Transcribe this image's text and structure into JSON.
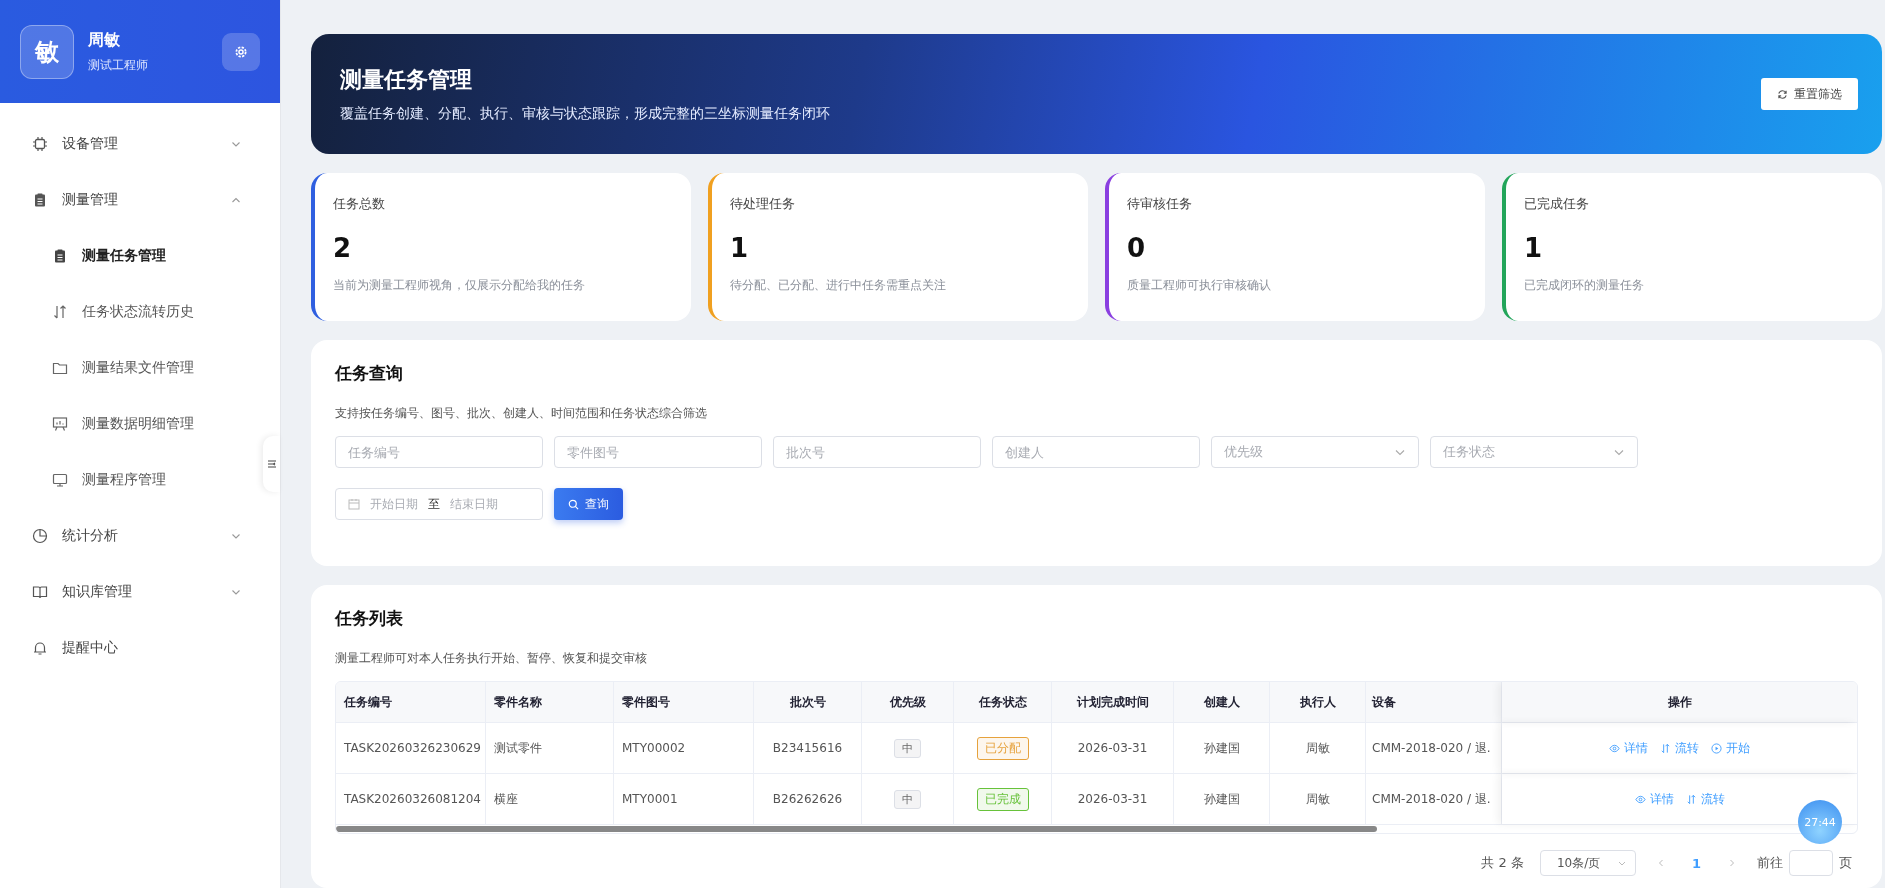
{
  "sidebar": {
    "avatar": "敏",
    "name": "周敏",
    "role": "测试工程师",
    "items": [
      {
        "label": "设备管理",
        "kind": "group",
        "expanded": false
      },
      {
        "label": "测量管理",
        "kind": "group",
        "expanded": true,
        "children": [
          {
            "label": "测量任务管理",
            "selected": true
          },
          {
            "label": "任务状态流转历史",
            "selected": false
          },
          {
            "label": "测量结果文件管理",
            "selected": false
          },
          {
            "label": "测量数据明细管理",
            "selected": false
          },
          {
            "label": "测量程序管理",
            "selected": false
          }
        ]
      },
      {
        "label": "统计分析",
        "kind": "group",
        "expanded": false
      },
      {
        "label": "知识库管理",
        "kind": "group",
        "expanded": false
      },
      {
        "label": "提醒中心",
        "kind": "link"
      }
    ]
  },
  "banner": {
    "title": "测量任务管理",
    "subtitle": "覆盖任务创建、分配、执行、审核与状态跟踪，形成完整的三坐标测量任务闭环",
    "reset_button": "重置筛选"
  },
  "stats": [
    {
      "label": "任务总数",
      "value": "2",
      "note": "当前为测量工程师视角，仅展示分配给我的任务",
      "color": "#2f5fe0"
    },
    {
      "label": "待处理任务",
      "value": "1",
      "note": "待分配、已分配、进行中任务需重点关注",
      "color": "#f0a020"
    },
    {
      "label": "待审核任务",
      "value": "0",
      "note": "质量工程师可执行审核确认",
      "color": "#8a3fe0"
    },
    {
      "label": "已完成任务",
      "value": "1",
      "note": "已完成闭环的测量任务",
      "color": "#22a55a"
    }
  ],
  "query": {
    "title": "任务查询",
    "description": "支持按任务编号、图号、批次、创建人、时间范围和任务状态综合筛选",
    "fields": [
      {
        "placeholder": "任务编号",
        "kind": "text"
      },
      {
        "placeholder": "零件图号",
        "kind": "text"
      },
      {
        "placeholder": "批次号",
        "kind": "text"
      },
      {
        "placeholder": "创建人",
        "kind": "text"
      },
      {
        "placeholder": "优先级",
        "kind": "select"
      },
      {
        "placeholder": "任务状态",
        "kind": "select"
      }
    ],
    "date_range": {
      "start_placeholder": "开始日期",
      "separator": "至",
      "end_placeholder": "结束日期"
    },
    "search_button": "查询"
  },
  "task_list": {
    "title": "任务列表",
    "description": "测量工程师可对本人任务执行开始、暂停、恢复和提交审核",
    "columns": [
      "任务编号",
      "零件名称",
      "零件图号",
      "批次号",
      "优先级",
      "任务状态",
      "计划完成时间",
      "创建人",
      "执行人",
      "设备",
      "操作"
    ],
    "rows": [
      {
        "task_no": "TASK20260326230629",
        "part_name": "测试零件",
        "drawing_no": "MTY00002",
        "batch": "B23415616",
        "priority": "中",
        "status": {
          "label": "已分配",
          "color": "#e6a23c"
        },
        "due": "2026-03-31",
        "creator": "孙建国",
        "executor": "周敏",
        "device": "CMM-2018-020 / 退.",
        "actions": [
          {
            "label": "详情",
            "kind": "detail"
          },
          {
            "label": "流转",
            "kind": "transfer"
          },
          {
            "label": "开始",
            "kind": "start"
          }
        ]
      },
      {
        "task_no": "TASK20260326081204",
        "part_name": "横座",
        "drawing_no": "MTY0001",
        "batch": "B26262626",
        "priority": "中",
        "status": {
          "label": "已完成",
          "color": "#67c23a"
        },
        "due": "2026-03-31",
        "creator": "孙建国",
        "executor": "周敏",
        "device": "CMM-2018-020 / 退.",
        "actions": [
          {
            "label": "详情",
            "kind": "detail"
          },
          {
            "label": "流转",
            "kind": "transfer"
          }
        ]
      }
    ]
  },
  "pagination": {
    "total": "共 2 条",
    "page_size": "10条/页",
    "pages": [
      {
        "label": "1",
        "selected": true
      }
    ],
    "goto_label": "前往",
    "page_suffix": "页"
  },
  "timer": "27:44"
}
